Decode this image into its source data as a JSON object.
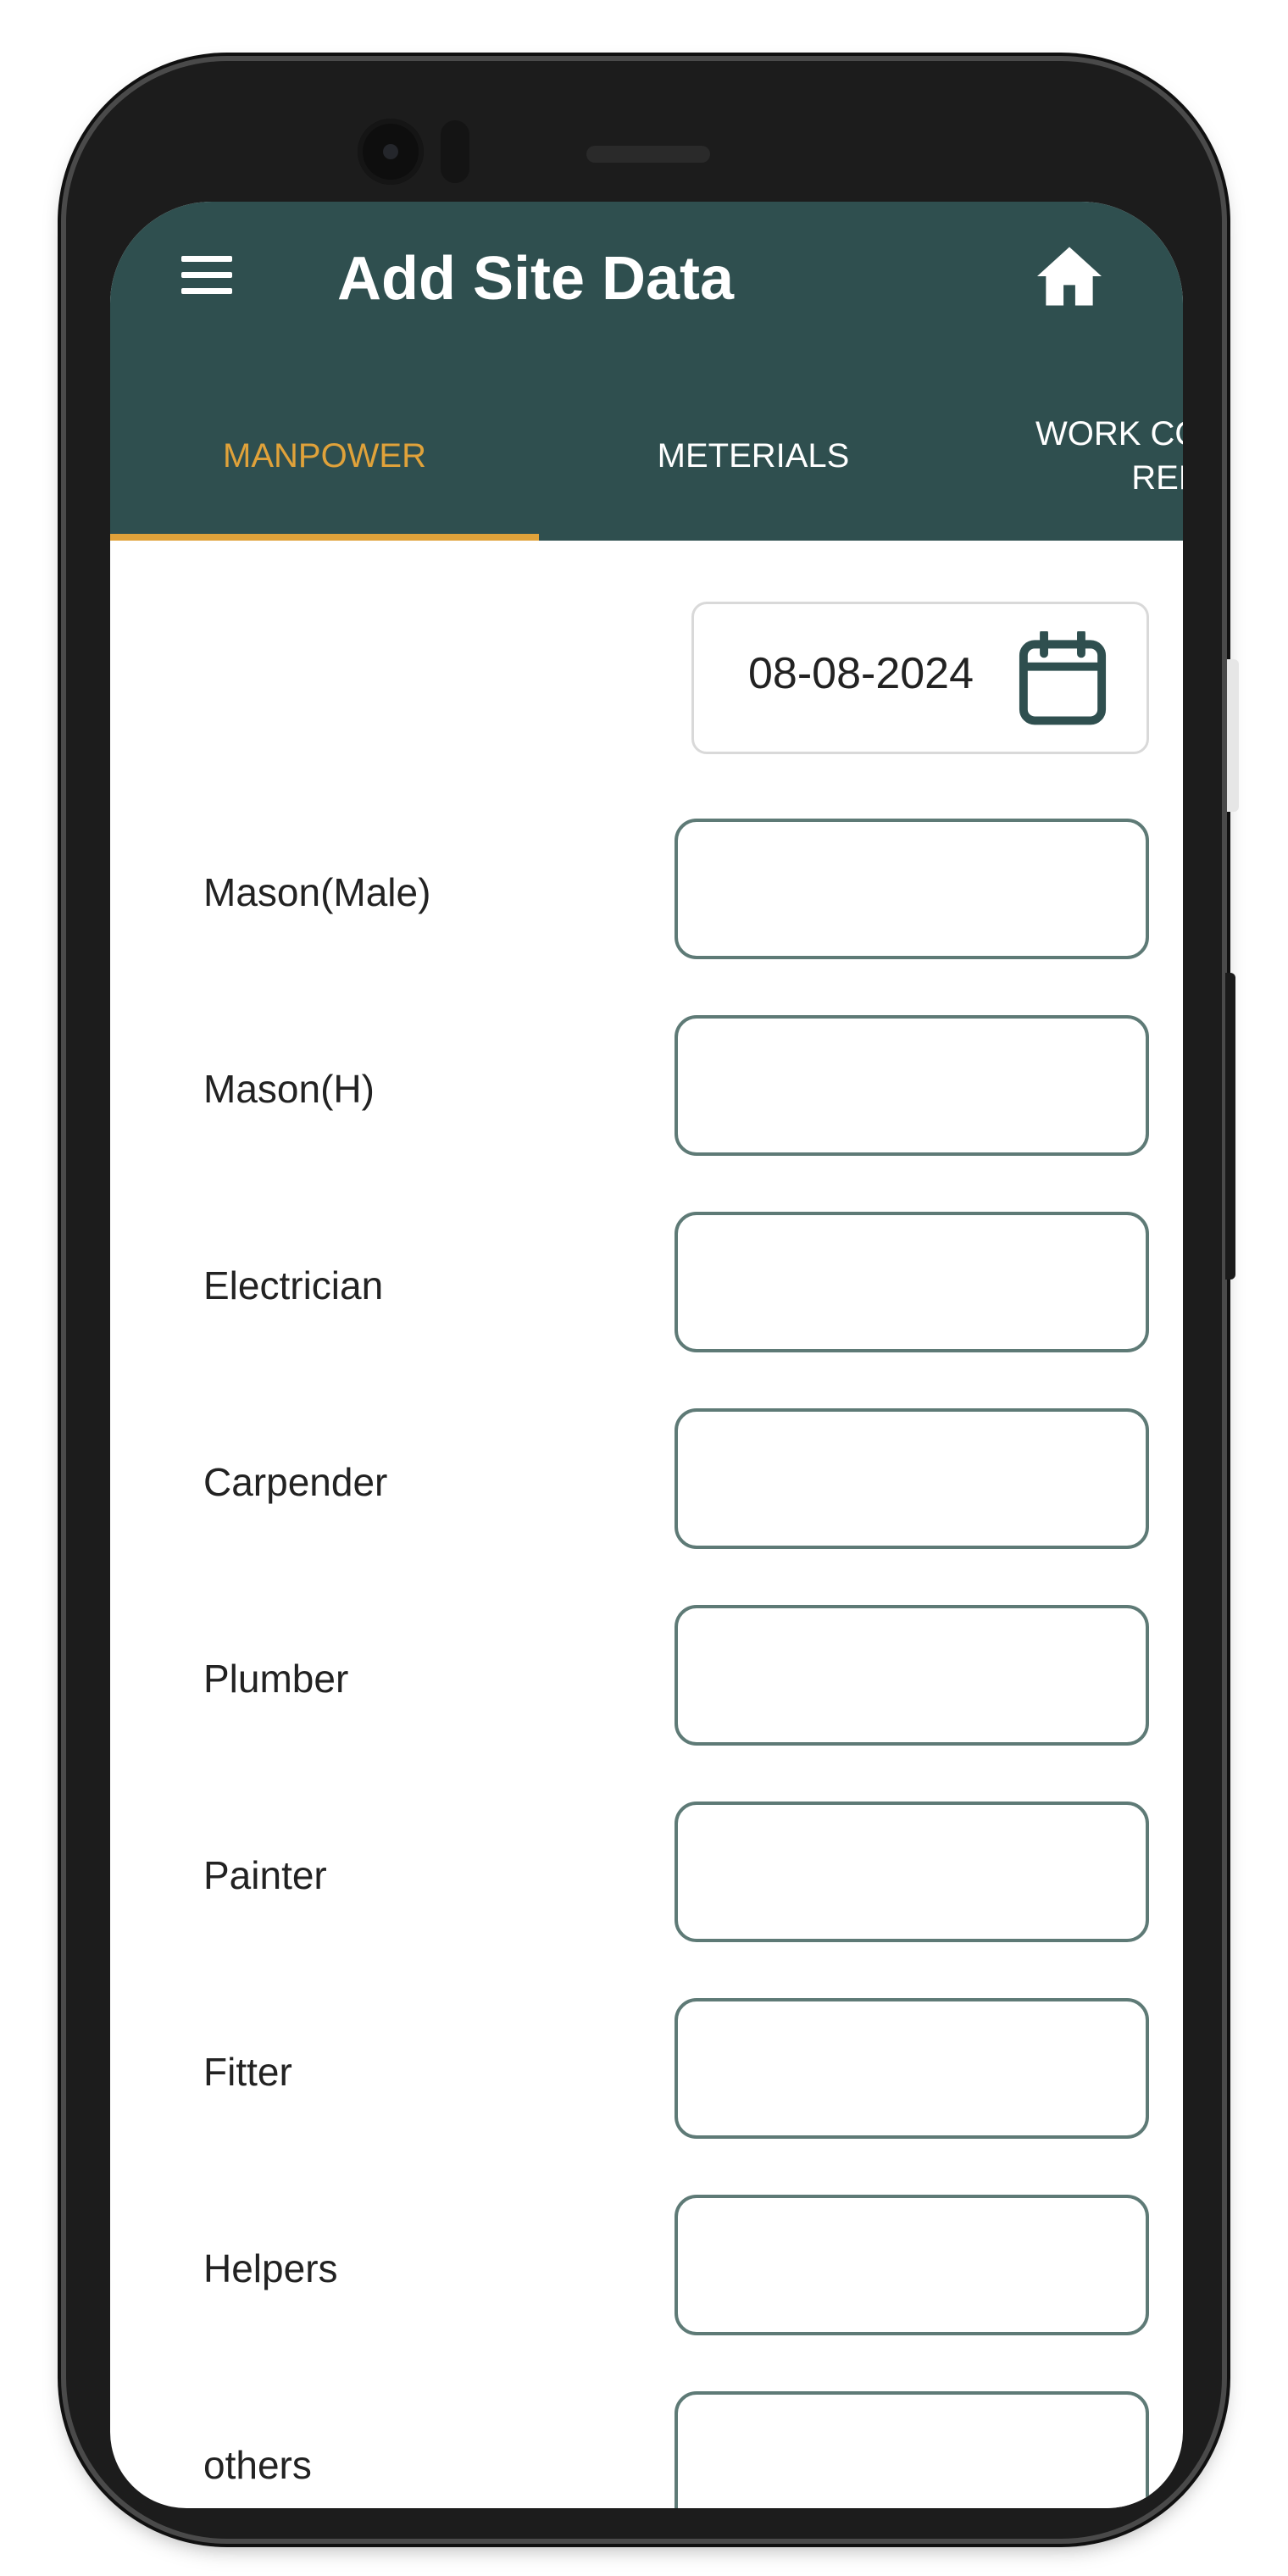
{
  "header": {
    "title": "Add Site Data",
    "menu_icon": "hamburger-menu-icon",
    "home_icon": "home-icon"
  },
  "tabs": [
    {
      "label": "MANPOWER",
      "selected": true
    },
    {
      "label": "METERIALS",
      "selected": false
    },
    {
      "label": "WORK CO\nREP",
      "selected": false
    }
  ],
  "date_picker": {
    "value": "08-08-2024",
    "icon": "calendar-icon"
  },
  "fields": [
    {
      "label": "Mason(Male)",
      "value": ""
    },
    {
      "label": "Mason(H)",
      "value": ""
    },
    {
      "label": "Electrician",
      "value": ""
    },
    {
      "label": "Carpender",
      "value": ""
    },
    {
      "label": "Plumber",
      "value": ""
    },
    {
      "label": "Painter",
      "value": ""
    },
    {
      "label": "Fitter",
      "value": ""
    },
    {
      "label": "Helpers",
      "value": ""
    },
    {
      "label": "others",
      "value": ""
    }
  ],
  "colors": {
    "appbar": "#2f4f4f",
    "tab_active": "#e0a23a",
    "input_border": "#5e7a76"
  }
}
